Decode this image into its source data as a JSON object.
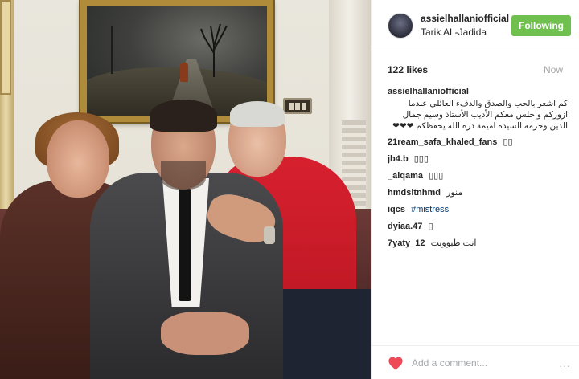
{
  "header": {
    "username": "assielhallaniofficial",
    "username_display": "assielhallaniofficial",
    "location": "Tarik AL-Jadida",
    "follow_label": "Following"
  },
  "stats": {
    "likes": "122 likes",
    "time": "Now"
  },
  "caption": {
    "author": "assielhallaniofficial",
    "text": "كم اشعر بالحب والصدق والدفء العائلي عندما ازوركم واجلس معكم الأديب الأستاذ وسيم جمال الدين وحرمه السيدة اميمة درة الله يحفظكم ❤❤❤"
  },
  "comments": [
    {
      "author": "21ream_safa_khaled_fans",
      "text": "▯▯"
    },
    {
      "author": "jb4.b",
      "text": "▯▯▯"
    },
    {
      "author": "_alqama",
      "text": "▯▯▯"
    },
    {
      "author": "hmdsltnhmd",
      "text": "منور"
    },
    {
      "author": "iqcs",
      "text": "#mistress"
    },
    {
      "author": "dyiaa.47",
      "text": "▯"
    },
    {
      "author": "7yaty_12",
      "text": "انت طيووبت"
    }
  ],
  "footer": {
    "placeholder": "Add a comment...",
    "more": "..."
  },
  "colors": {
    "follow_button": "#70c050",
    "like_heart": "#ed4956",
    "hashtag": "#003569",
    "muted": "#a5a7aa"
  },
  "icons": {
    "like": "heart-icon",
    "more": "ellipsis-icon"
  }
}
